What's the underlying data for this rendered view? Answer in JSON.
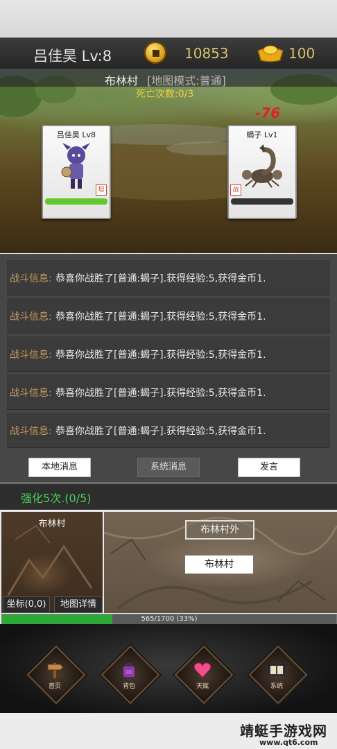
{
  "header": {
    "player": "吕佳昊 Lv:8",
    "gold": "10853",
    "ingot": "100",
    "icons": {
      "coin": "copper-coin-icon",
      "ingot": "gold-ingot-icon"
    }
  },
  "scene": {
    "map_name": "布林村",
    "map_mode": "[地图模式:普通]",
    "death_count": "死亡次数:0/3",
    "damage": "-76",
    "player_card": {
      "name": "吕佳昊 Lv8",
      "tag": "坦",
      "hp_color": "#62c82e"
    },
    "enemy_card": {
      "name": "蝎子 Lv1",
      "tag": "战",
      "hp_color": "#333333"
    }
  },
  "messages": [
    {
      "prefix": "战斗信息:",
      "text": "恭喜你战胜了[普通:蝎子].获得经验:5,获得金币1."
    },
    {
      "prefix": "战斗信息:",
      "text": "恭喜你战胜了[普通:蝎子].获得经验:5,获得金币1."
    },
    {
      "prefix": "战斗信息:",
      "text": "恭喜你战胜了[普通:蝎子].获得经验:5,获得金币1."
    },
    {
      "prefix": "战斗信息:",
      "text": "恭喜你战胜了[普通:蝎子].获得经验:5,获得金币1."
    },
    {
      "prefix": "战斗信息:",
      "text": "恭喜你战胜了[普通:蝎子].获得经验:5,获得金币1."
    }
  ],
  "message_tabs": {
    "local": "本地消息",
    "system": "系统消息",
    "speak": "发言"
  },
  "quest": "强化5次.(0/5)",
  "map": {
    "mini_title": "布林村",
    "coords": "坐标(0,0)",
    "details": "地图详情",
    "outside": "布林村外",
    "village": "布林村"
  },
  "exp": {
    "text": "565/1700 (33%)",
    "percent": 33
  },
  "nav": [
    {
      "label": "首页",
      "icon": "signpost-icon"
    },
    {
      "label": "背包",
      "icon": "backpack-icon"
    },
    {
      "label": "天赋",
      "icon": "heart-icon"
    },
    {
      "label": "系统",
      "icon": "book-icon"
    }
  ],
  "watermark": {
    "title": "靖蜓手游戏网",
    "url": "www.qt6.com"
  }
}
